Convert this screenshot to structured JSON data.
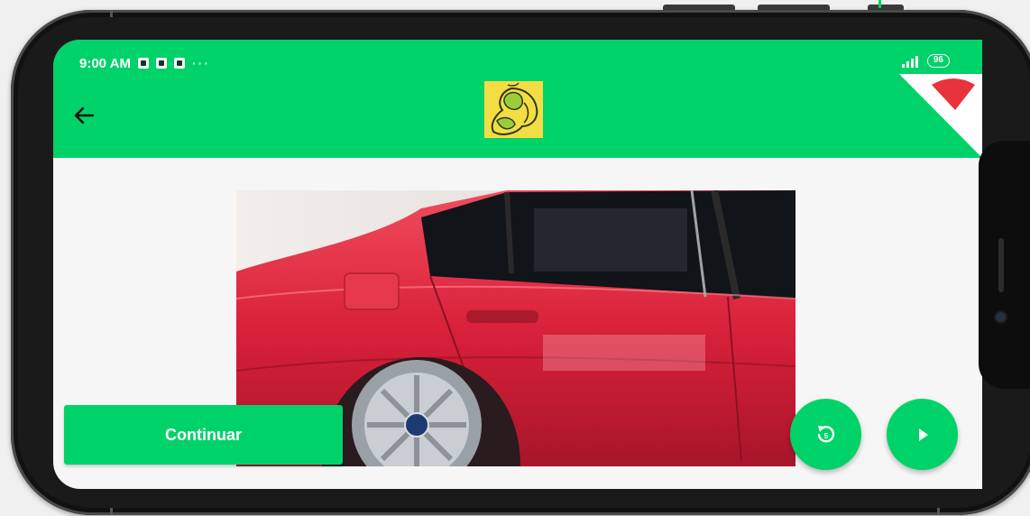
{
  "status_bar": {
    "time": "9:00 AM",
    "dots": "···",
    "battery": "96"
  },
  "app_bar": {
    "back_icon": "arrow-left-icon",
    "logo": "mother-child-logo",
    "corner_icon": "red-triangle-marker"
  },
  "content": {
    "image_subject": "red-car-side-photo"
  },
  "actions": {
    "continue_label": "Continuar",
    "retake_icon": "rotate-ccw-icon",
    "play_icon": "play-icon"
  },
  "colors": {
    "accent": "#00d26a",
    "logo_bg": "#f4dd44",
    "marker": "#e8323c"
  }
}
